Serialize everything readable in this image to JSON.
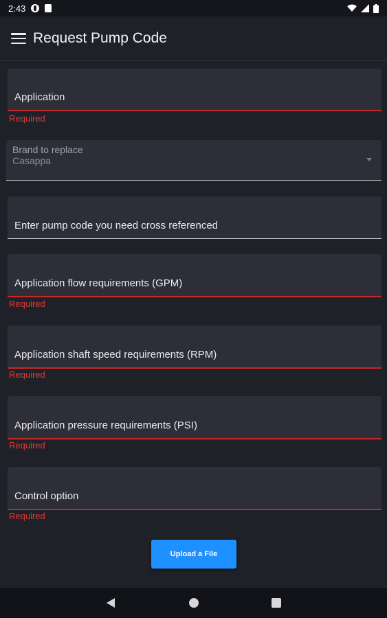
{
  "status_bar": {
    "time": "2:43",
    "icons": [
      "pinterest-icon",
      "sd-card-icon",
      "wifi-icon",
      "signal-icon",
      "battery-icon"
    ]
  },
  "app_bar": {
    "title": "Request Pump Code",
    "menu_icon": "hamburger-menu-icon"
  },
  "fields": {
    "application": {
      "label": "Application",
      "error": "Required"
    },
    "brand": {
      "label": "Brand to replace",
      "value": "Casappa"
    },
    "pump_code": {
      "label": "Enter pump code you need cross referenced"
    },
    "flow": {
      "label": "Application flow requirements (GPM)",
      "error": "Required"
    },
    "shaft_speed": {
      "label": "Application shaft speed requirements (RPM)",
      "error": "Required"
    },
    "pressure": {
      "label": "Application pressure requirements (PSI)",
      "error": "Required"
    },
    "control": {
      "label": "Control option",
      "error": "Required"
    }
  },
  "upload_button": {
    "label": "Upload a File"
  },
  "nav_bar": {
    "icons": [
      "back-icon",
      "home-icon",
      "recents-icon"
    ]
  },
  "colors": {
    "background": "#1f2128",
    "field_background": "#2d2e38",
    "error": "#e53935",
    "accent": "#1e90ff"
  }
}
